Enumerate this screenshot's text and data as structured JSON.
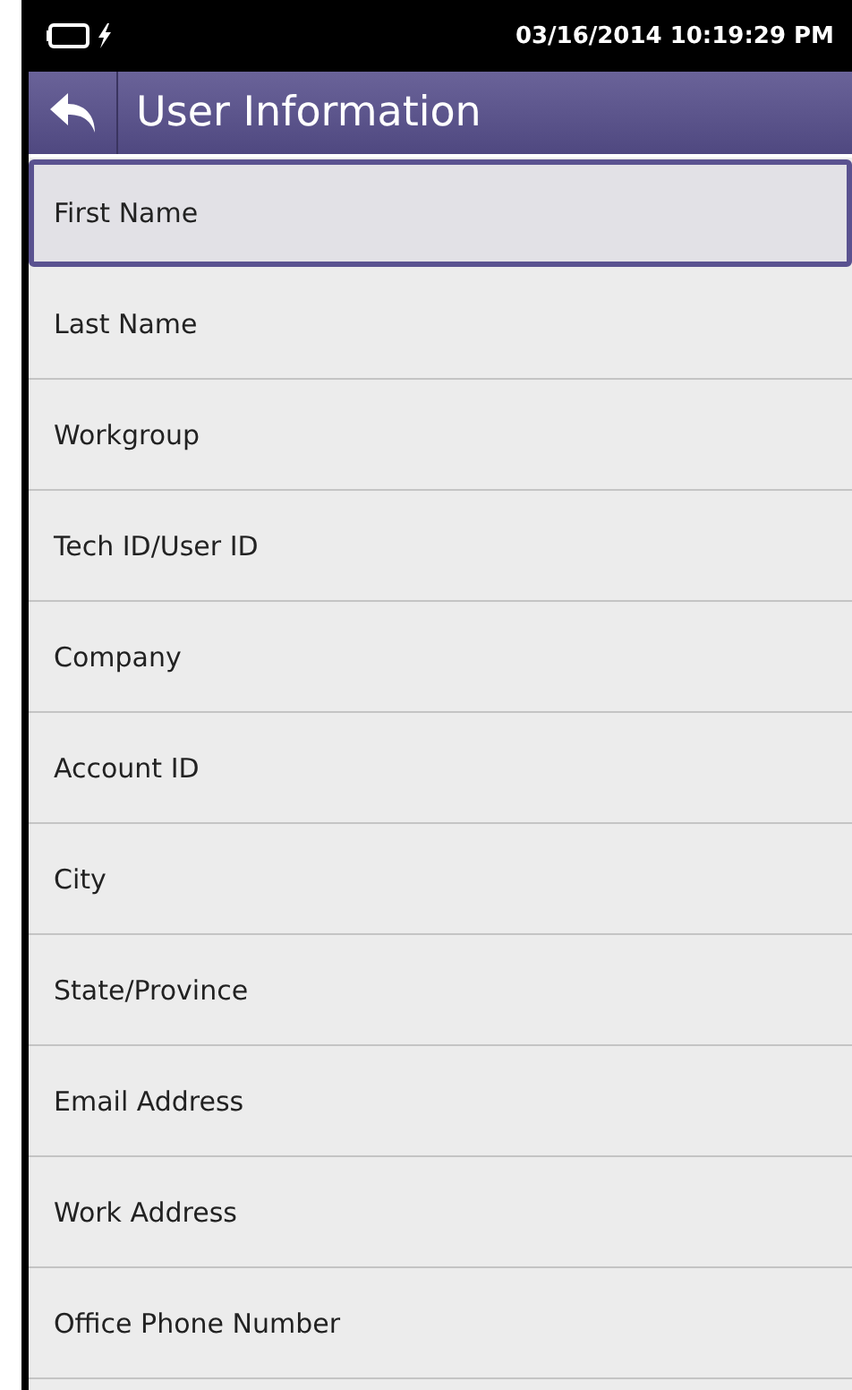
{
  "status_bar": {
    "datetime": "03/16/2014 10:19:29 PM",
    "charging": true
  },
  "header": {
    "title": "User Information"
  },
  "fields": [
    {
      "label": "First Name",
      "selected": true
    },
    {
      "label": "Last Name",
      "selected": false
    },
    {
      "label": "Workgroup",
      "selected": false
    },
    {
      "label": "Tech ID/User ID",
      "selected": false
    },
    {
      "label": "Company",
      "selected": false
    },
    {
      "label": "Account ID",
      "selected": false
    },
    {
      "label": "City",
      "selected": false
    },
    {
      "label": "State/Province",
      "selected": false
    },
    {
      "label": "Email Address",
      "selected": false
    },
    {
      "label": "Work Address",
      "selected": false
    },
    {
      "label": "Office Phone Number",
      "selected": false
    }
  ]
}
